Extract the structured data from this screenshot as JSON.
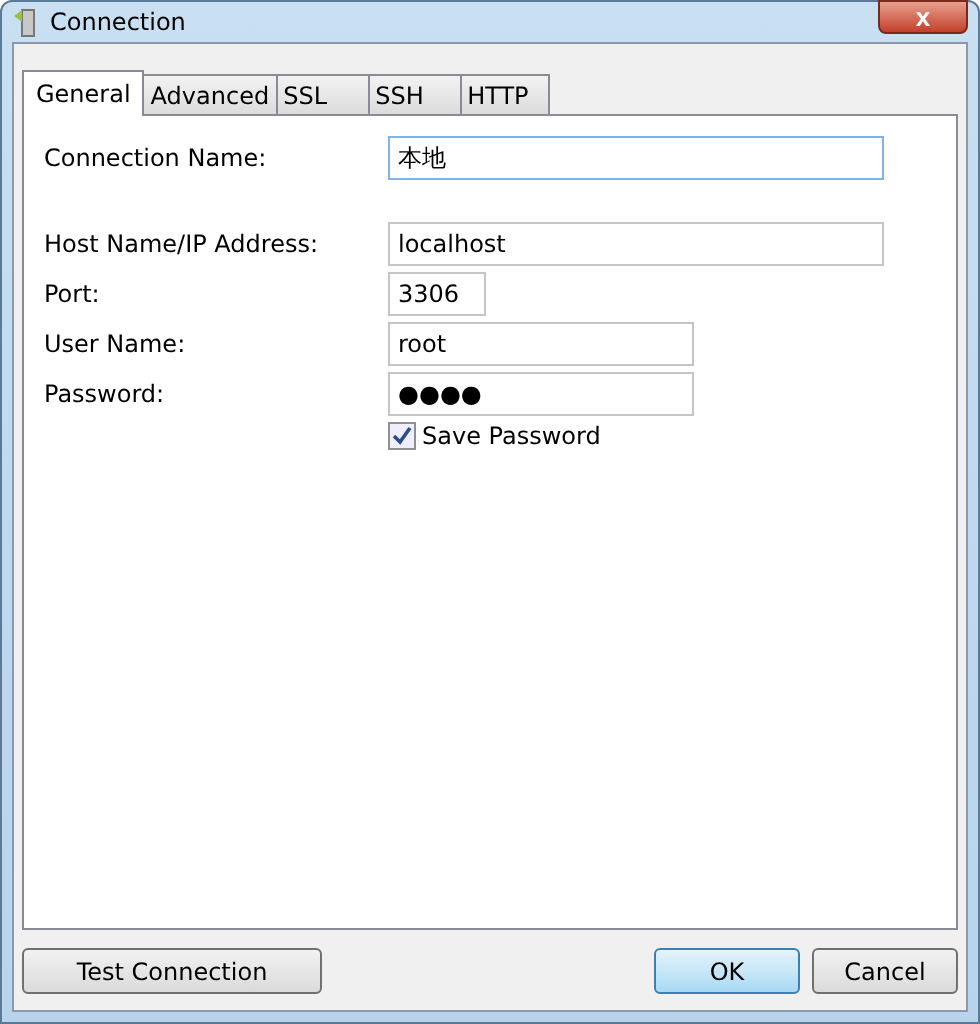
{
  "window": {
    "title": "Connection",
    "close_symbol": "x"
  },
  "tabs": [
    {
      "label": "General",
      "selected": true
    },
    {
      "label": "Advanced",
      "selected": false
    },
    {
      "label": "SSL",
      "selected": false
    },
    {
      "label": "SSH",
      "selected": false
    },
    {
      "label": "HTTP",
      "selected": false
    }
  ],
  "fields": [
    {
      "label": "Connection Name:",
      "value": "本地",
      "kind": "name",
      "focused": true
    },
    {
      "label": "Host Name/IP Address:",
      "value": "localhost",
      "kind": "host",
      "focused": false
    },
    {
      "label": "Port:",
      "value": "3306",
      "kind": "port",
      "focused": false
    },
    {
      "label": "User Name:",
      "value": "root",
      "kind": "user",
      "focused": false
    },
    {
      "label": "Password:",
      "value": "●●●●",
      "kind": "password",
      "focused": false
    }
  ],
  "save_password": {
    "label": "Save Password",
    "checked": true
  },
  "buttons": [
    {
      "label": "Test Connection",
      "kind": "test",
      "default": false
    },
    {
      "label": "OK",
      "kind": "ok",
      "default": true
    },
    {
      "label": "Cancel",
      "kind": "cancel",
      "default": false
    }
  ]
}
